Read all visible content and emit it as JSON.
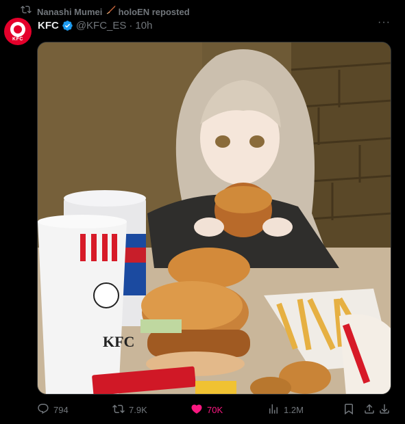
{
  "repost": {
    "user": "Nanashi Mumei",
    "org": "holoEN",
    "action": "reposted"
  },
  "tweet": {
    "display_name": "KFC",
    "handle": "@KFC_ES",
    "separator": "·",
    "time": "10h",
    "avatar_text": "KFC"
  },
  "media": {
    "cup_logo_text": "KFC"
  },
  "actions": {
    "replies": "794",
    "reposts": "7.9K",
    "likes": "70K",
    "views": "1.2M"
  },
  "colors": {
    "background": "#000000",
    "muted": "#71767b",
    "like": "#f91880",
    "verified": "#1d9bf0",
    "kfc_red": "#e4002b"
  }
}
